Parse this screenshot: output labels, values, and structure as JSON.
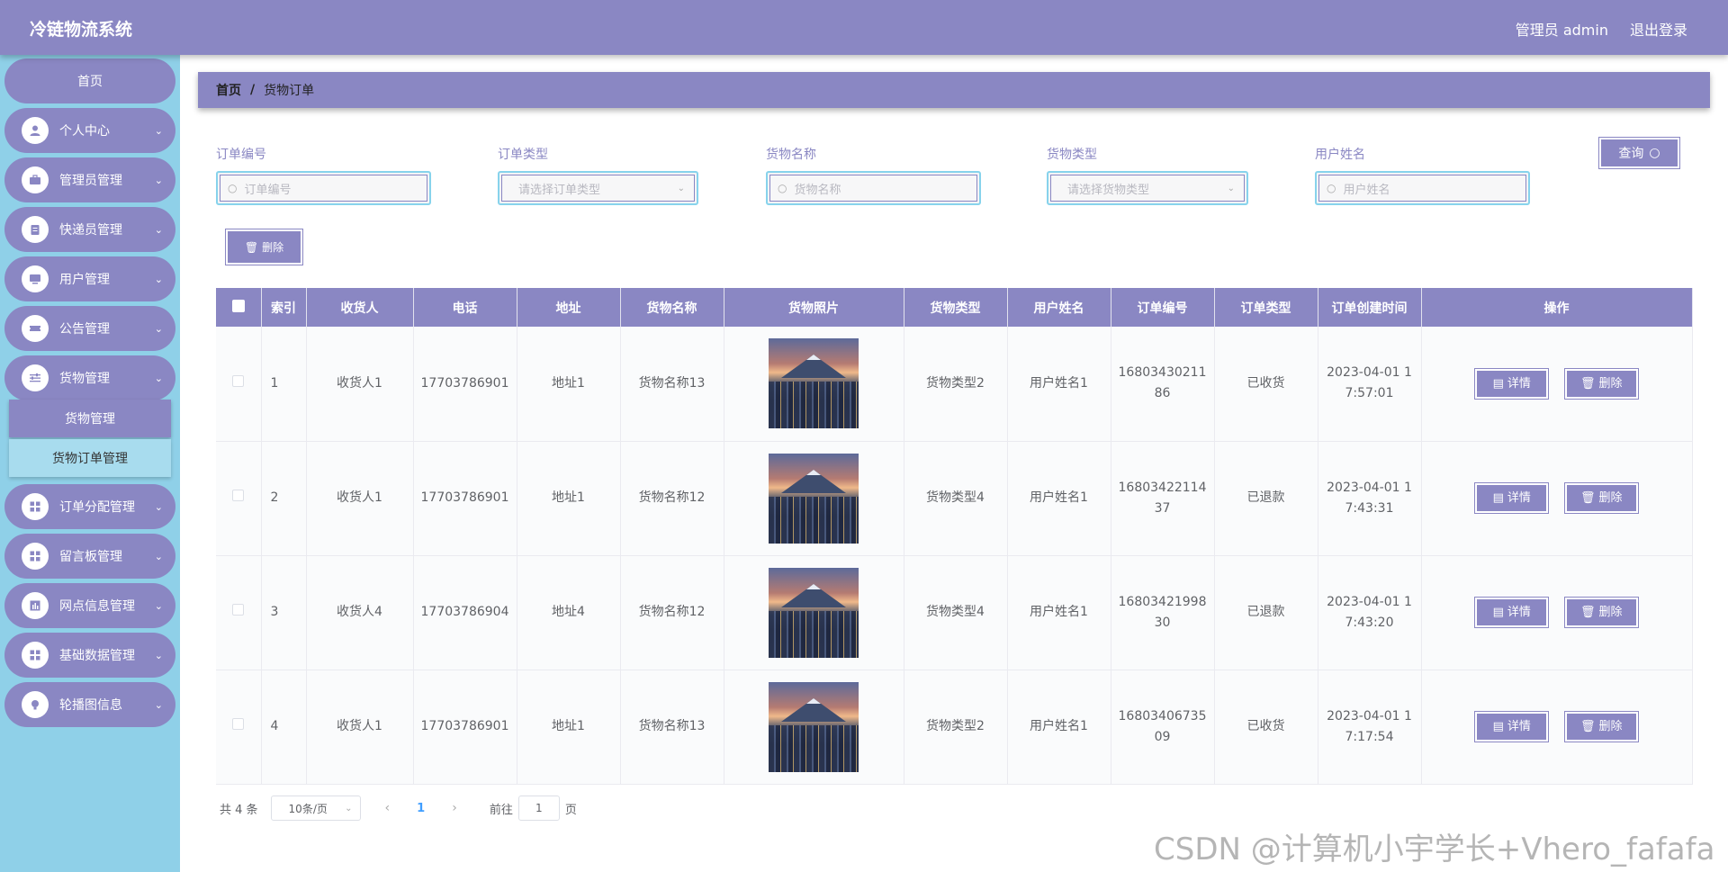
{
  "header": {
    "app_title": "冷链物流系统",
    "user_label": "管理员 admin",
    "logout_label": "退出登录"
  },
  "sidebar": {
    "home": "首页",
    "items": [
      {
        "label": "个人中心",
        "icon": "user-icon"
      },
      {
        "label": "管理员管理",
        "icon": "briefcase-icon"
      },
      {
        "label": "快递员管理",
        "icon": "clipboard-icon"
      },
      {
        "label": "用户管理",
        "icon": "monitor-icon"
      },
      {
        "label": "公告管理",
        "icon": "ticket-icon"
      },
      {
        "label": "货物管理",
        "icon": "sliders-icon"
      },
      {
        "label": "订单分配管理",
        "icon": "grid-icon"
      },
      {
        "label": "留言板管理",
        "icon": "grid-icon"
      },
      {
        "label": "网点信息管理",
        "icon": "chart-icon"
      },
      {
        "label": "基础数据管理",
        "icon": "grid-icon"
      },
      {
        "label": "轮播图信息",
        "icon": "bulb-icon"
      }
    ],
    "submenu": {
      "item_a": "货物管理",
      "item_b": "货物订单管理"
    }
  },
  "breadcrumb": {
    "home": "首页",
    "separator": "/",
    "current": "货物订单"
  },
  "search": {
    "order_no": {
      "label": "订单编号",
      "placeholder": "订单编号"
    },
    "order_type": {
      "label": "订单类型",
      "placeholder": "请选择订单类型"
    },
    "goods_name": {
      "label": "货物名称",
      "placeholder": "货物名称"
    },
    "goods_type": {
      "label": "货物类型",
      "placeholder": "请选择货物类型"
    },
    "user_name": {
      "label": "用户姓名",
      "placeholder": "用户姓名"
    },
    "query_label": "查询"
  },
  "toolbar": {
    "delete_label": "删除"
  },
  "table": {
    "columns": [
      "索引",
      "收货人",
      "电话",
      "地址",
      "货物名称",
      "货物照片",
      "货物类型",
      "用户姓名",
      "订单编号",
      "订单类型",
      "订单创建时间",
      "操作"
    ],
    "rows": [
      {
        "index": "1",
        "receiver": "收货人1",
        "phone": "17703786901",
        "address": "地址1",
        "goods_name": "货物名称13",
        "goods_type": "货物类型2",
        "user_name": "用户姓名1",
        "order_no_1": "16803430211",
        "order_no_2": "86",
        "order_type": "已收货",
        "time_1": "2023-04-01 1",
        "time_2": "7:57:01"
      },
      {
        "index": "2",
        "receiver": "收货人1",
        "phone": "17703786901",
        "address": "地址1",
        "goods_name": "货物名称12",
        "goods_type": "货物类型4",
        "user_name": "用户姓名1",
        "order_no_1": "16803422114",
        "order_no_2": "37",
        "order_type": "已退款",
        "time_1": "2023-04-01 1",
        "time_2": "7:43:31"
      },
      {
        "index": "3",
        "receiver": "收货人4",
        "phone": "17703786904",
        "address": "地址4",
        "goods_name": "货物名称12",
        "goods_type": "货物类型4",
        "user_name": "用户姓名1",
        "order_no_1": "16803421998",
        "order_no_2": "30",
        "order_type": "已退款",
        "time_1": "2023-04-01 1",
        "time_2": "7:43:20"
      },
      {
        "index": "4",
        "receiver": "收货人1",
        "phone": "17703786901",
        "address": "地址1",
        "goods_name": "货物名称13",
        "goods_type": "货物类型2",
        "user_name": "用户姓名1",
        "order_no_1": "16803406735",
        "order_no_2": "09",
        "order_type": "已收货",
        "time_1": "2023-04-01 1",
        "time_2": "7:17:54"
      }
    ],
    "detail_label": "详情",
    "delete_label": "删除"
  },
  "pagination": {
    "total": "共 4 条",
    "page_size": "10条/页",
    "current_page": "1",
    "goto_label": "前往",
    "goto_value": "1",
    "page_label": "页"
  },
  "watermark": "CSDN @计算机小宇学长+Vhero_fafafa",
  "colors": {
    "primary": "#8a87c3",
    "sidebar_bg": "#8fd0e8",
    "accent": "#87d3ec"
  }
}
